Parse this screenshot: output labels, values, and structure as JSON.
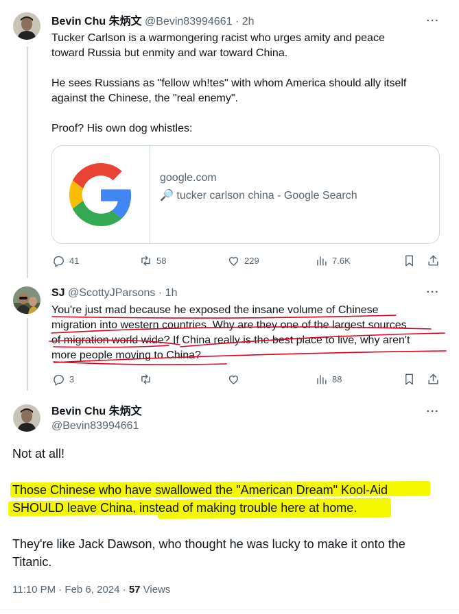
{
  "tweet1": {
    "name": "Bevin Chu 朱炳文",
    "handle": "@Bevin83994661",
    "time": "· 2h",
    "lines": [
      "Tucker Carlson is a warmongering racist who urges amity and peace",
      "toward Russia but enmity and war toward China.",
      "",
      "He sees Russians as \"fellow wh!tes\" with whom America should ally itself",
      "against the Chinese, the \"real enemy\".",
      "",
      "Proof? His own dog whistles:"
    ],
    "card": {
      "domain": "google.com",
      "title": "🔎 tucker carlson china - Google Search"
    },
    "replies": "41",
    "reposts": "58",
    "likes": "229",
    "views": "7.6K"
  },
  "tweet2": {
    "name": "SJ",
    "handle": "@ScottyJParsons",
    "time": "· 1h",
    "lines": [
      "You're just mad because he exposed the insane volume of Chinese",
      "migration into western countries. Why are they one of the largest sources",
      "of migration world wide? If China really is the best place to live, why aren't",
      "more people moving to China?"
    ],
    "replies": "3",
    "views": "88"
  },
  "tweet3": {
    "name": "Bevin Chu 朱炳文",
    "handle": "@Bevin83994661",
    "line1": "Not at all!",
    "line2": "Those Chinese who have swallowed the \"American Dream\" Kool-Aid",
    "line3": "SHOULD leave China, instead of making trouble here at home.",
    "line4": "They're like Jack Dawson, who thought he was lucky to make it onto the",
    "line5": "Titanic.",
    "timestamp": "11:10 PM · Feb 6, 2024 · ",
    "views_count": "57",
    "views_label": " Views"
  },
  "colors": {
    "text": "#0f1419",
    "muted": "#536471",
    "highlight": "#f3f700",
    "underline": "#e0001a"
  },
  "icons": [
    "more-icon",
    "reply-icon",
    "repost-icon",
    "like-icon",
    "views-icon",
    "bookmark-icon",
    "share-icon",
    "google-logo-icon"
  ]
}
